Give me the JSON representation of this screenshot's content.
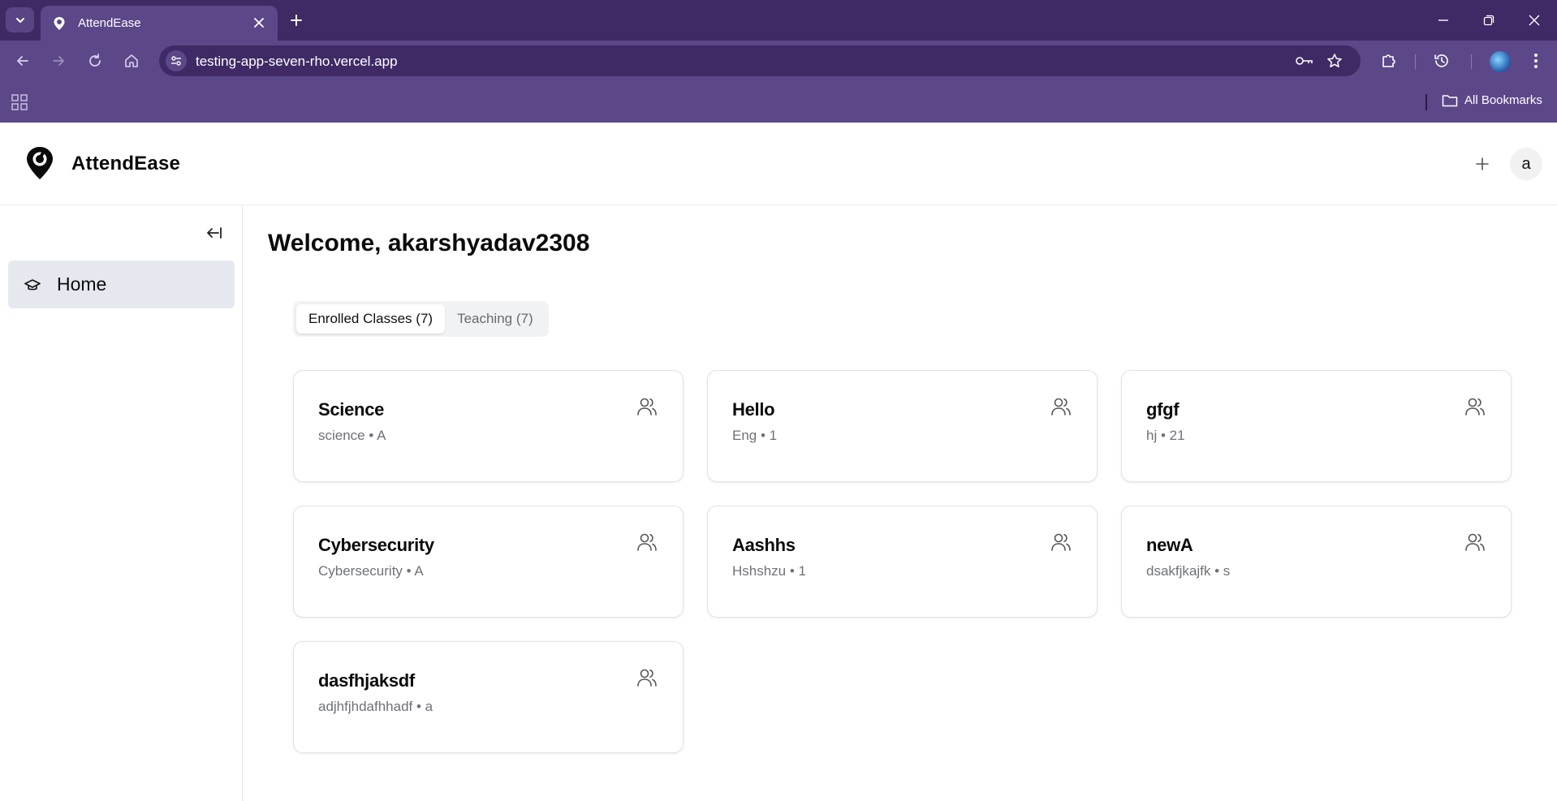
{
  "browser": {
    "tab_title": "AttendEase",
    "url": "testing-app-seven-rho.vercel.app",
    "bookmarks_label": "All Bookmarks"
  },
  "app": {
    "brand": "AttendEase",
    "user_initial": "a"
  },
  "sidebar": {
    "items": [
      {
        "label": "Home",
        "icon": "graduation-cap-icon",
        "active": true
      }
    ]
  },
  "main": {
    "welcome": "Welcome, akarshyadav2308",
    "tabs": [
      {
        "label": "Enrolled Classes (7)",
        "active": true
      },
      {
        "label": "Teaching (7)",
        "active": false
      }
    ],
    "classes": [
      {
        "title": "Science",
        "subtitle": "science • A"
      },
      {
        "title": "Hello",
        "subtitle": "Eng • 1"
      },
      {
        "title": "gfgf",
        "subtitle": "hj • 21"
      },
      {
        "title": "Cybersecurity",
        "subtitle": "Cybersecurity • A"
      },
      {
        "title": "Aashhs",
        "subtitle": "Hshshzu • 1"
      },
      {
        "title": "newA",
        "subtitle": "dsakfjkajfk • s"
      },
      {
        "title": "dasfhjaksdf",
        "subtitle": "adjhfjhdafhhadf • a"
      }
    ]
  },
  "colors": {
    "chrome_dark": "#3f2a66",
    "chrome": "#5c4789",
    "nav_active_bg": "#e5e9ef"
  }
}
